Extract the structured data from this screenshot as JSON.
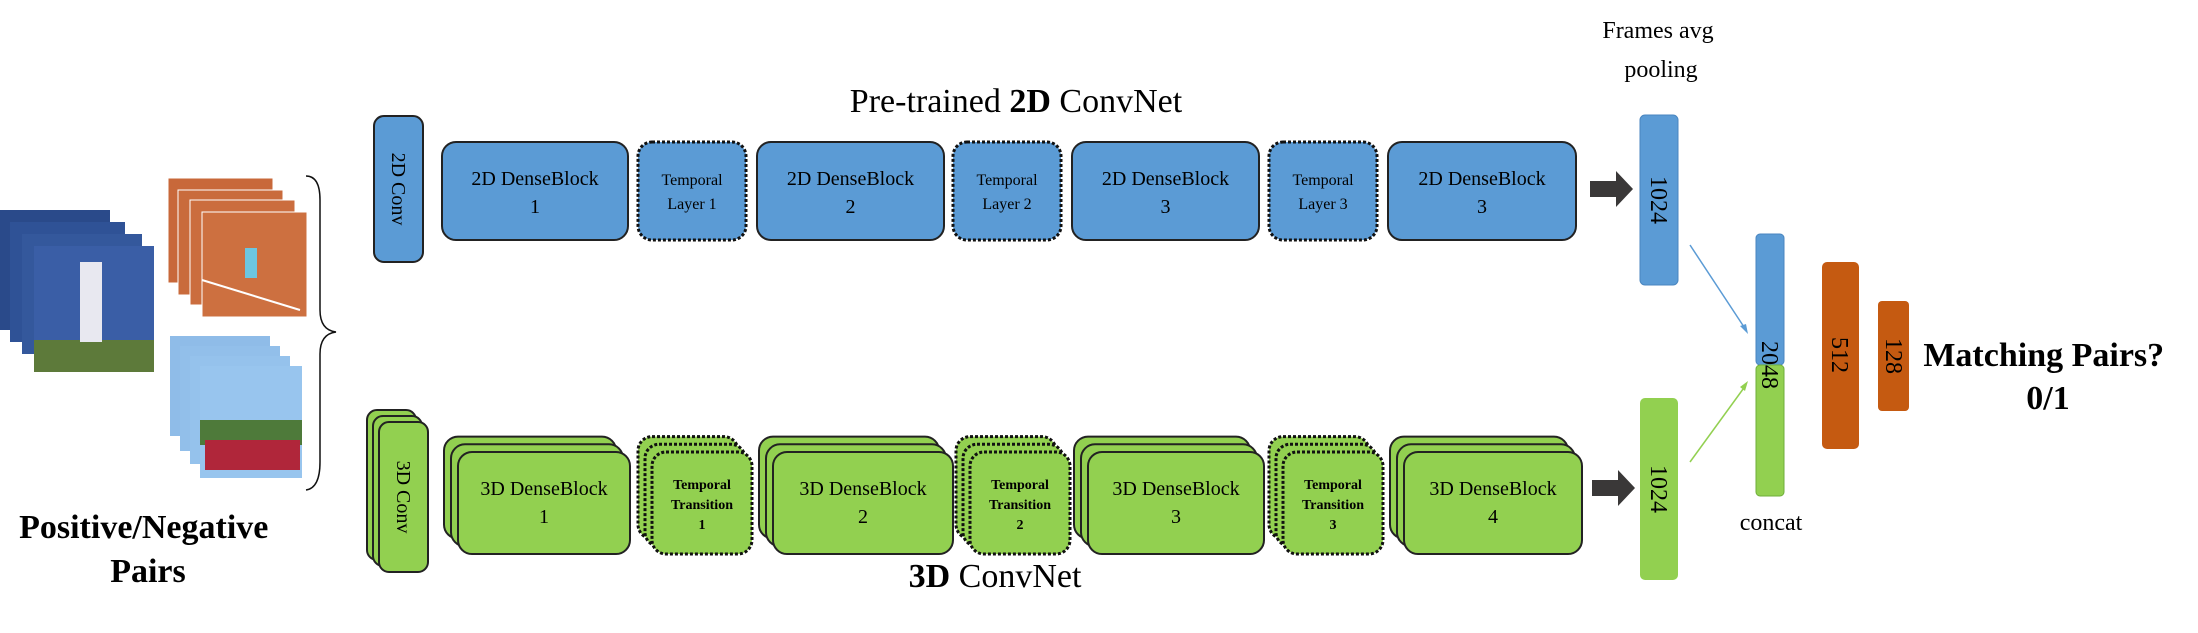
{
  "title": {
    "prefix": "Pre-trained ",
    "bold": "2D",
    "suffix": " ConvNet"
  },
  "bottom_title": {
    "bold": "3D",
    "suffix": " ConvNet"
  },
  "input_label": [
    "Positive/Negative",
    "Pairs"
  ],
  "conv2d": "2D Conv",
  "conv3d": "3D Conv",
  "top_blocks": [
    {
      "type": "dense",
      "lines": [
        "2D DenseBlock",
        "1"
      ]
    },
    {
      "type": "temporal",
      "lines": [
        "Temporal",
        "Layer 1"
      ]
    },
    {
      "type": "dense",
      "lines": [
        "2D DenseBlock",
        "2"
      ]
    },
    {
      "type": "temporal",
      "lines": [
        "Temporal",
        "Layer 2"
      ]
    },
    {
      "type": "dense",
      "lines": [
        "2D DenseBlock",
        "3"
      ]
    },
    {
      "type": "temporal",
      "lines": [
        "Temporal",
        "Layer 3"
      ]
    },
    {
      "type": "dense",
      "lines": [
        "2D DenseBlock",
        "3"
      ]
    }
  ],
  "bottom_blocks": [
    {
      "type": "dense",
      "lines": [
        "3D DenseBlock",
        "1"
      ]
    },
    {
      "type": "temporal",
      "lines": [
        "Temporal",
        "Transition",
        "1"
      ]
    },
    {
      "type": "dense",
      "lines": [
        "3D DenseBlock",
        "2"
      ]
    },
    {
      "type": "temporal",
      "lines": [
        "Temporal",
        "Transition",
        "2"
      ]
    },
    {
      "type": "dense",
      "lines": [
        "3D DenseBlock",
        "3"
      ]
    },
    {
      "type": "temporal",
      "lines": [
        "Temporal",
        "Transition",
        "3"
      ]
    },
    {
      "type": "dense",
      "lines": [
        "3D DenseBlock",
        "4"
      ]
    }
  ],
  "pooling_label": [
    "Frames avg",
    "pooling"
  ],
  "top_feature": "1024",
  "bottom_feature": "1024",
  "concat_dim": "2048",
  "concat_label": "concat",
  "fc1": "512",
  "fc2": "128",
  "output": [
    "Matching Pairs?",
    "0/1"
  ],
  "colors": {
    "blue": "#5B9BD5",
    "green": "#92D050",
    "orange": "#C55A11",
    "arrow": "#3A3838"
  }
}
